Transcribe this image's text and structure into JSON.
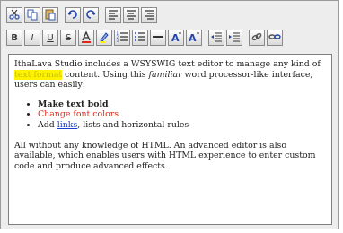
{
  "toolbar": {
    "row1": [
      {
        "name": "cut-icon"
      },
      {
        "name": "copy-icon"
      },
      {
        "name": "paste-icon"
      },
      {
        "name": "undo-icon"
      },
      {
        "name": "redo-icon"
      },
      {
        "name": "align-left-icon"
      },
      {
        "name": "align-center-icon"
      },
      {
        "name": "align-right-icon"
      }
    ],
    "row2": {
      "bold": "B",
      "italic": "I",
      "underline": "U",
      "strike": "S"
    }
  },
  "colors": {
    "highlight": "#fff200",
    "red_text": "#e0291a",
    "link": "#1a3ccf"
  },
  "content": {
    "p1_a": "IthaLava Studio includes a WSYSWIG text editor to manage any kind of ",
    "p1_highlight": "text format",
    "p1_b": " content. Using this ",
    "p1_italic": "familiar",
    "p1_c": " word processor-like interface, users can easily:",
    "bullets": {
      "b1": "Make text bold",
      "b2": "Change font colors",
      "b3_a": "Add ",
      "b3_link": "links",
      "b3_b": ", lists and horizontal rules"
    },
    "p2": "All without any knowledge of HTML. An advanced editor is also available, which enables users with HTML experience to enter custom code and produce advanced effects."
  }
}
